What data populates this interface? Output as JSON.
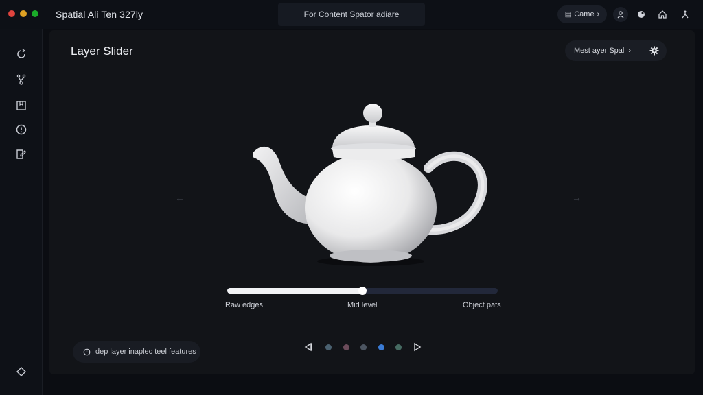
{
  "window": {
    "title": "Spatial Ali Ten 327ly",
    "center_tab": "For Content Spator adiare",
    "pill_button": "Came",
    "colors": {
      "close": "#e0443e",
      "minimize": "#dea123",
      "maximize": "#1aab29",
      "background": "#0b0d12",
      "panel": "#121418"
    }
  },
  "topbar_icons": [
    "person-icon",
    "puzzle-icon",
    "home-icon",
    "share-icon"
  ],
  "sidebar": {
    "items": [
      "refresh-icon",
      "network-icon",
      "bookmark-icon",
      "info-icon",
      "note-icon"
    ],
    "bottom": "diamond-icon"
  },
  "panel": {
    "title": "Layer Slider",
    "next_button": "Mest ayer Spal",
    "settings": "gear-icon"
  },
  "slider": {
    "value": 0.5,
    "labels": [
      "Raw edges",
      "Mid level",
      "Object pats"
    ]
  },
  "footer": {
    "hint": "dep layer inaplec teel features",
    "pager": {
      "dots": [
        "#4a6170",
        "#6b4b5a",
        "#4c5561",
        "#3a7bd5",
        "#466b62"
      ],
      "active_index": 3
    }
  }
}
